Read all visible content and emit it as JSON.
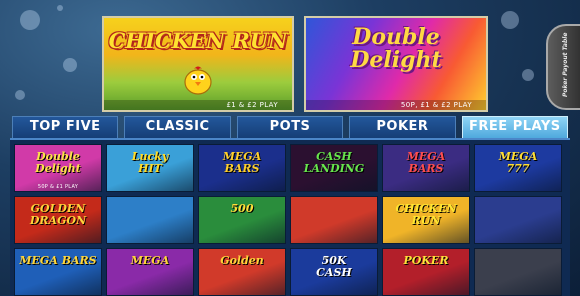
{
  "featured": [
    {
      "title": "CHICKEN RUN",
      "stakes": "£1 & £2 PLAY"
    },
    {
      "title": "Double Delight",
      "stakes": "50P, £1 & £2 PLAY"
    }
  ],
  "side_button": {
    "label": "Poker Payout Table"
  },
  "tabs": [
    {
      "label": "TOP FIVE",
      "active": false
    },
    {
      "label": "CLASSIC",
      "active": false
    },
    {
      "label": "POTS",
      "active": false
    },
    {
      "label": "POKER",
      "active": false
    },
    {
      "label": "FREE PLAYS",
      "active": true
    }
  ],
  "games": [
    {
      "title": "Double\nDelight",
      "stakes": "50P & £1 PLAY",
      "bg": "#d13aa8",
      "fg": "#ffe14a"
    },
    {
      "title": "Lucky\nHIT",
      "stakes": "",
      "bg": "#3aa0d8",
      "fg": "#ffdc27"
    },
    {
      "title": "MEGA\nBARS",
      "stakes": "",
      "bg": "#1b2f8c",
      "fg": "#ffd02b"
    },
    {
      "title": "CASH\nLANDING",
      "stakes": "",
      "bg": "#2b1030",
      "fg": "#67e64c"
    },
    {
      "title": "MEGA\nBARS",
      "stakes": "",
      "bg": "#3b2c82",
      "fg": "#ff4d4d"
    },
    {
      "title": "MEGA\n777",
      "stakes": "",
      "bg": "#1d3aa0",
      "fg": "#ffdd33"
    },
    {
      "title": "GOLDEN DRAGON",
      "stakes": "",
      "bg": "#c42a1a",
      "fg": "#ffd23a"
    },
    {
      "title": "",
      "stakes": "",
      "bg": "#2d7fc8",
      "fg": "#ffe23a"
    },
    {
      "title": "500",
      "stakes": "",
      "bg": "#2a8d3c",
      "fg": "#ffdd38"
    },
    {
      "title": "",
      "stakes": "",
      "bg": "#d03a2a",
      "fg": "#ffcf2a"
    },
    {
      "title": "CHICKEN RUN",
      "stakes": "",
      "bg": "#f0b428",
      "fg": "#ffe631"
    },
    {
      "title": "",
      "stakes": "",
      "bg": "#2b3d8f",
      "fg": "#8fe0ff"
    },
    {
      "title": "MEGA BARS",
      "stakes": "",
      "bg": "#1f5fb8",
      "fg": "#ffd63a"
    },
    {
      "title": "MEGA",
      "stakes": "",
      "bg": "#8a2aa8",
      "fg": "#ffd43a"
    },
    {
      "title": "Golden",
      "stakes": "",
      "bg": "#d13a2a",
      "fg": "#ffd43a"
    },
    {
      "title": "50K\nCASH",
      "stakes": "",
      "bg": "#1b3b9c",
      "fg": "#ffffff"
    },
    {
      "title": "POKER",
      "stakes": "",
      "bg": "#b31f2a",
      "fg": "#ffe23a"
    },
    {
      "title": "",
      "stakes": "",
      "bg": "#3b3f4d",
      "fg": "#ffffff"
    }
  ]
}
